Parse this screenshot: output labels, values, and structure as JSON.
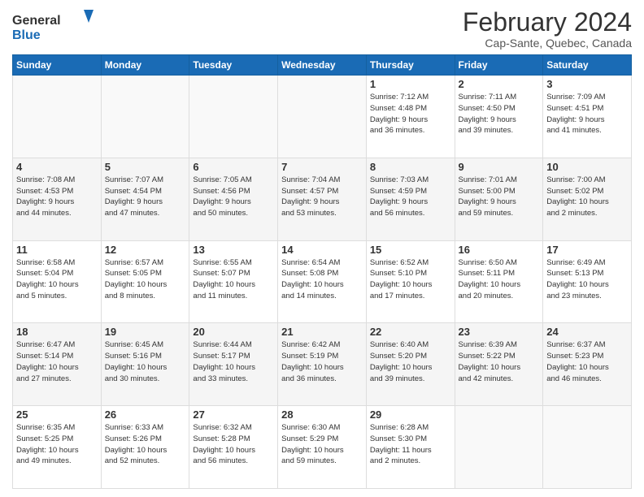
{
  "logo": {
    "line1": "General",
    "line2": "Blue"
  },
  "title": "February 2024",
  "subtitle": "Cap-Sante, Quebec, Canada",
  "days_of_week": [
    "Sunday",
    "Monday",
    "Tuesday",
    "Wednesday",
    "Thursday",
    "Friday",
    "Saturday"
  ],
  "weeks": [
    [
      {
        "day": "",
        "info": ""
      },
      {
        "day": "",
        "info": ""
      },
      {
        "day": "",
        "info": ""
      },
      {
        "day": "",
        "info": ""
      },
      {
        "day": "1",
        "info": "Sunrise: 7:12 AM\nSunset: 4:48 PM\nDaylight: 9 hours\nand 36 minutes."
      },
      {
        "day": "2",
        "info": "Sunrise: 7:11 AM\nSunset: 4:50 PM\nDaylight: 9 hours\nand 39 minutes."
      },
      {
        "day": "3",
        "info": "Sunrise: 7:09 AM\nSunset: 4:51 PM\nDaylight: 9 hours\nand 41 minutes."
      }
    ],
    [
      {
        "day": "4",
        "info": "Sunrise: 7:08 AM\nSunset: 4:53 PM\nDaylight: 9 hours\nand 44 minutes."
      },
      {
        "day": "5",
        "info": "Sunrise: 7:07 AM\nSunset: 4:54 PM\nDaylight: 9 hours\nand 47 minutes."
      },
      {
        "day": "6",
        "info": "Sunrise: 7:05 AM\nSunset: 4:56 PM\nDaylight: 9 hours\nand 50 minutes."
      },
      {
        "day": "7",
        "info": "Sunrise: 7:04 AM\nSunset: 4:57 PM\nDaylight: 9 hours\nand 53 minutes."
      },
      {
        "day": "8",
        "info": "Sunrise: 7:03 AM\nSunset: 4:59 PM\nDaylight: 9 hours\nand 56 minutes."
      },
      {
        "day": "9",
        "info": "Sunrise: 7:01 AM\nSunset: 5:00 PM\nDaylight: 9 hours\nand 59 minutes."
      },
      {
        "day": "10",
        "info": "Sunrise: 7:00 AM\nSunset: 5:02 PM\nDaylight: 10 hours\nand 2 minutes."
      }
    ],
    [
      {
        "day": "11",
        "info": "Sunrise: 6:58 AM\nSunset: 5:04 PM\nDaylight: 10 hours\nand 5 minutes."
      },
      {
        "day": "12",
        "info": "Sunrise: 6:57 AM\nSunset: 5:05 PM\nDaylight: 10 hours\nand 8 minutes."
      },
      {
        "day": "13",
        "info": "Sunrise: 6:55 AM\nSunset: 5:07 PM\nDaylight: 10 hours\nand 11 minutes."
      },
      {
        "day": "14",
        "info": "Sunrise: 6:54 AM\nSunset: 5:08 PM\nDaylight: 10 hours\nand 14 minutes."
      },
      {
        "day": "15",
        "info": "Sunrise: 6:52 AM\nSunset: 5:10 PM\nDaylight: 10 hours\nand 17 minutes."
      },
      {
        "day": "16",
        "info": "Sunrise: 6:50 AM\nSunset: 5:11 PM\nDaylight: 10 hours\nand 20 minutes."
      },
      {
        "day": "17",
        "info": "Sunrise: 6:49 AM\nSunset: 5:13 PM\nDaylight: 10 hours\nand 23 minutes."
      }
    ],
    [
      {
        "day": "18",
        "info": "Sunrise: 6:47 AM\nSunset: 5:14 PM\nDaylight: 10 hours\nand 27 minutes."
      },
      {
        "day": "19",
        "info": "Sunrise: 6:45 AM\nSunset: 5:16 PM\nDaylight: 10 hours\nand 30 minutes."
      },
      {
        "day": "20",
        "info": "Sunrise: 6:44 AM\nSunset: 5:17 PM\nDaylight: 10 hours\nand 33 minutes."
      },
      {
        "day": "21",
        "info": "Sunrise: 6:42 AM\nSunset: 5:19 PM\nDaylight: 10 hours\nand 36 minutes."
      },
      {
        "day": "22",
        "info": "Sunrise: 6:40 AM\nSunset: 5:20 PM\nDaylight: 10 hours\nand 39 minutes."
      },
      {
        "day": "23",
        "info": "Sunrise: 6:39 AM\nSunset: 5:22 PM\nDaylight: 10 hours\nand 42 minutes."
      },
      {
        "day": "24",
        "info": "Sunrise: 6:37 AM\nSunset: 5:23 PM\nDaylight: 10 hours\nand 46 minutes."
      }
    ],
    [
      {
        "day": "25",
        "info": "Sunrise: 6:35 AM\nSunset: 5:25 PM\nDaylight: 10 hours\nand 49 minutes."
      },
      {
        "day": "26",
        "info": "Sunrise: 6:33 AM\nSunset: 5:26 PM\nDaylight: 10 hours\nand 52 minutes."
      },
      {
        "day": "27",
        "info": "Sunrise: 6:32 AM\nSunset: 5:28 PM\nDaylight: 10 hours\nand 56 minutes."
      },
      {
        "day": "28",
        "info": "Sunrise: 6:30 AM\nSunset: 5:29 PM\nDaylight: 10 hours\nand 59 minutes."
      },
      {
        "day": "29",
        "info": "Sunrise: 6:28 AM\nSunset: 5:30 PM\nDaylight: 11 hours\nand 2 minutes."
      },
      {
        "day": "",
        "info": ""
      },
      {
        "day": "",
        "info": ""
      }
    ]
  ]
}
